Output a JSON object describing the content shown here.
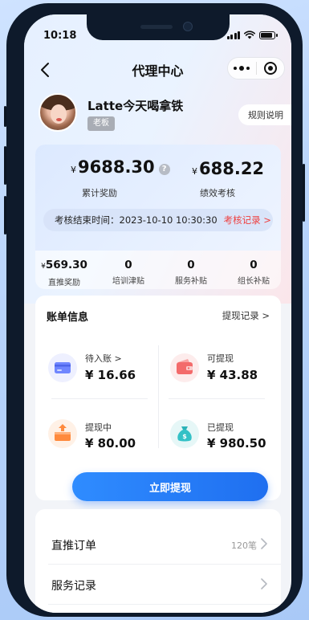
{
  "status_bar": {
    "time": "10:18"
  },
  "nav": {
    "title": "代理中心"
  },
  "user": {
    "name": "Latte今天喝拿铁",
    "role": "老板",
    "rules_label": "规则说明"
  },
  "earnings": {
    "currency": "¥",
    "total_reward": "9688.30",
    "total_reward_label": "累计奖励",
    "performance": "688.22",
    "performance_label": "绩效考核",
    "assess_text": "考核结束时间：2023-10-10 10:30:30",
    "assess_record": "考核记录 >"
  },
  "stats": [
    {
      "value": "569.30",
      "currency": "¥",
      "label": "直推奖励"
    },
    {
      "value": "0",
      "label": "培训津贴"
    },
    {
      "value": "0",
      "label": "服务补贴"
    },
    {
      "value": "0",
      "label": "组长补贴"
    }
  ],
  "bill": {
    "title": "账单信息",
    "record_link": "提现记录 >",
    "cells": [
      {
        "label": "待入账 >",
        "value": "¥ 16.66",
        "icon": "card-icon"
      },
      {
        "label": "可提现",
        "value": "¥ 43.88",
        "icon": "wallet-icon"
      },
      {
        "label": "提现中",
        "value": "¥ 80.00",
        "icon": "upload-box-icon"
      },
      {
        "label": "已提现",
        "value": "¥ 980.50",
        "icon": "money-bag-icon"
      }
    ],
    "withdraw_button": "立即提现"
  },
  "list": [
    {
      "label": "直推订单",
      "meta": "120笔"
    },
    {
      "label": "服务记录",
      "meta": ""
    }
  ],
  "colors": {
    "primary": "#1f6ff0",
    "accent_red": "#ef3e3e",
    "page_bg": "#f2f4f8"
  }
}
